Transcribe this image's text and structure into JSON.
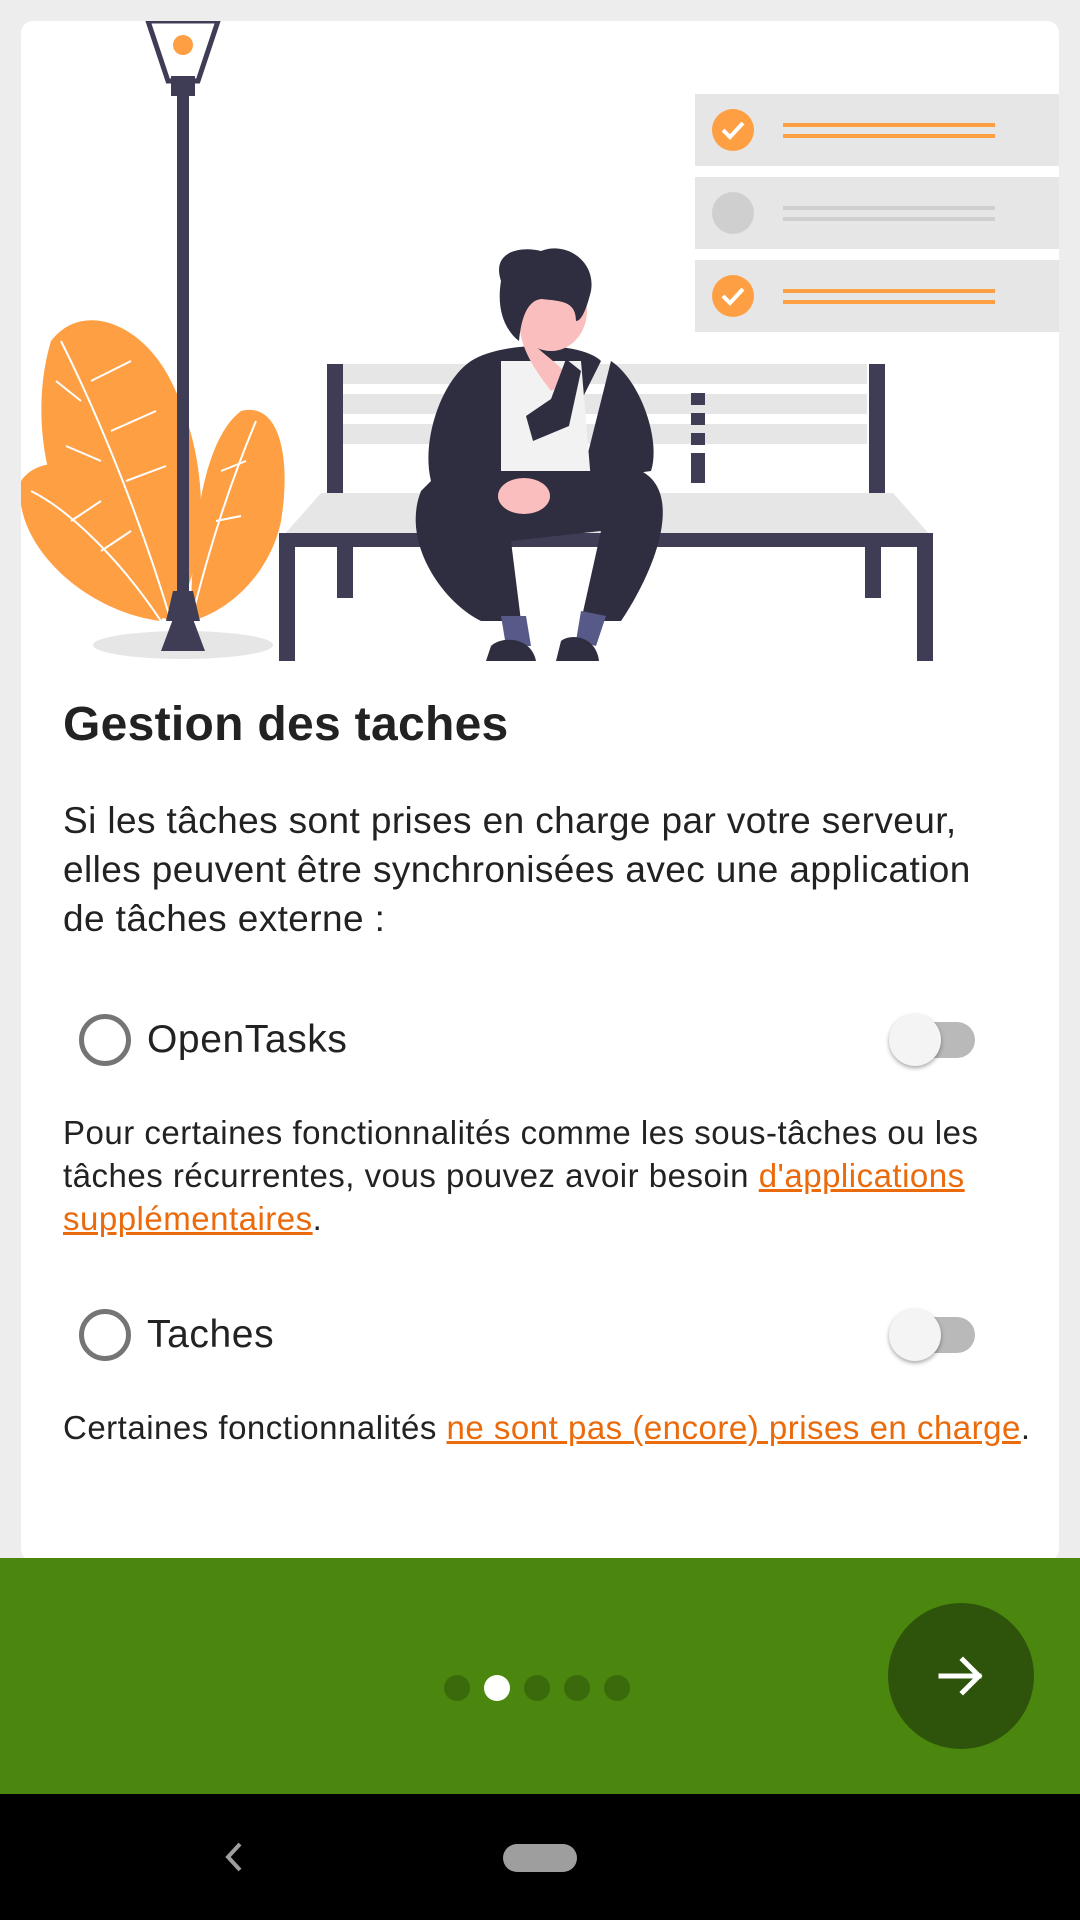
{
  "colors": {
    "accent": "#ea6a0c",
    "bar_green": "#4b860f",
    "next_button": "#2e530b",
    "illustration_orange": "#ff9f43",
    "illustration_dark": "#3f3d56"
  },
  "illustration": {
    "icon": "person-on-bench-illustration"
  },
  "content": {
    "title": "Gestion des taches",
    "intro": "Si les tâches sont prises en charge par votre serveur, elles peuvent être synchronisées avec une application de tâches externe :",
    "options": [
      {
        "label": "OpenTasks",
        "selected": false,
        "enabled": false,
        "note_text": "Pour certaines fonctionnalités comme les sous-tâches ou les tâches récurrentes, vous pouvez avoir besoin ",
        "note_link": "d'applications supplémentaires",
        "note_after": "."
      },
      {
        "label": "Taches",
        "selected": false,
        "enabled": false,
        "note_text": "Certaines fonctionnalités ",
        "note_link": "ne sont pas (encore) prises en charge",
        "note_after": "."
      }
    ]
  },
  "pager": {
    "page_count": 5,
    "current_page": 2,
    "next_icon": "arrow-right-icon"
  },
  "system_nav": {
    "back_icon": "back-chevron-icon",
    "home_icon": "home-pill-icon"
  }
}
